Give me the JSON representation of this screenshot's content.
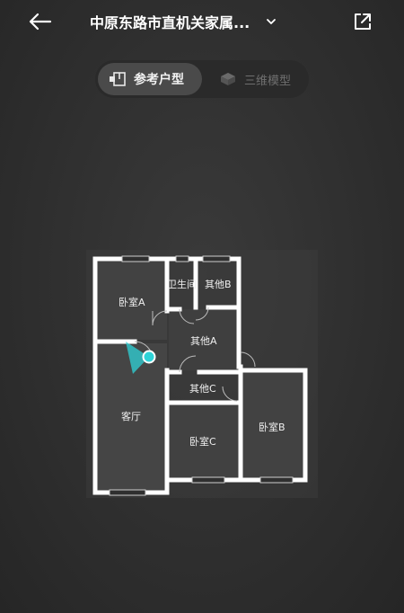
{
  "header": {
    "title": "中原东路市直机关家属...",
    "back_icon": "arrow-left-icon",
    "dropdown_icon": "chevron-down-icon",
    "share_icon": "external-link-icon"
  },
  "tabs": [
    {
      "label": "参考户型",
      "icon": "floorplan-icon",
      "active": true
    },
    {
      "label": "三维模型",
      "icon": "3d-model-icon",
      "active": false
    }
  ],
  "floorplan": {
    "rooms": {
      "bedroom_a": "卧室A",
      "bathroom": "卫生间",
      "other_b": "其他B",
      "other_a": "其他A",
      "living_room": "客厅",
      "other_c": "其他C",
      "bedroom_c": "卧室C",
      "bedroom_b": "卧室B"
    },
    "colors": {
      "wall": "#ffffff",
      "viewpoint": "#2fd3d8",
      "background": "#2f2f2f"
    }
  }
}
